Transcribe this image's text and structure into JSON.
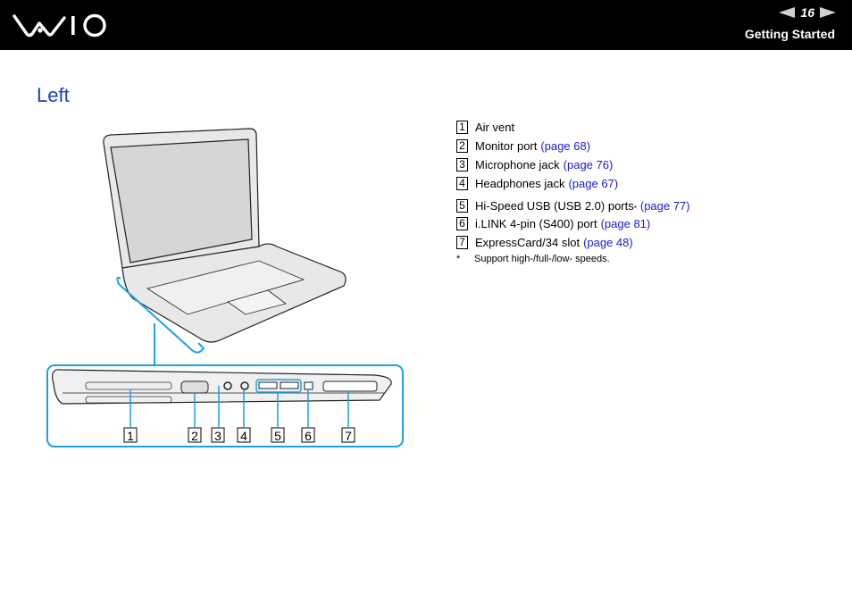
{
  "header": {
    "logo": "VAIO",
    "page_number": "16",
    "prev_icon": "arrow-left-icon",
    "next_icon": "arrow-right-icon",
    "section": "Getting Started"
  },
  "title": "Left",
  "items": [
    {
      "num": "1",
      "label": "Air vent",
      "link": ""
    },
    {
      "num": "2",
      "label": "Monitor port",
      "link": "(page 68)"
    },
    {
      "num": "3",
      "label": "Microphone jack",
      "link": "(page 76)"
    },
    {
      "num": "4",
      "label": "Headphones jack",
      "link": "(page 67)"
    },
    {
      "num": "5",
      "label": "Hi-Speed USB (USB 2.0) ports",
      "sup": "*",
      "link": "(page 77)"
    },
    {
      "num": "6",
      "label": "i.LINK 4-pin (S400) port",
      "link": "(page 81)"
    },
    {
      "num": "7",
      "label": "ExpressCard/34 slot",
      "link": "(page 48)"
    }
  ],
  "footnote": {
    "mark": "*",
    "text": "Support high-/full-/low- speeds."
  },
  "callouts": [
    "1",
    "2",
    "3",
    "4",
    "5",
    "6",
    "7"
  ],
  "colors": {
    "title": "#1f3fbf",
    "link": "#1a1ad6",
    "callout_line": "#1ba1e2"
  }
}
